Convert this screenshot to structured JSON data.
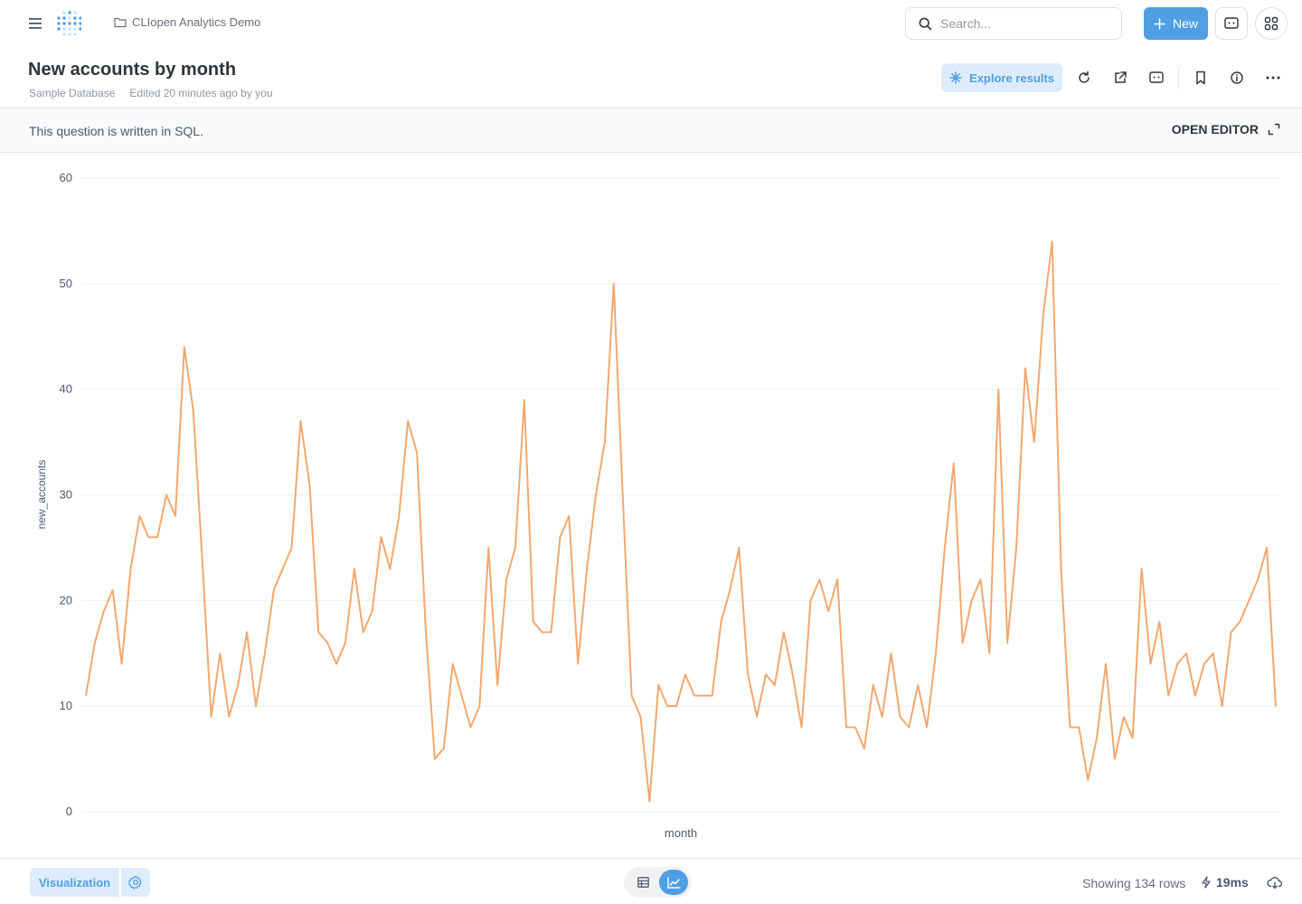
{
  "colors": {
    "accent": "#509ee3",
    "accent_light": "#ddecfa",
    "line": "#f2a86f",
    "text": "#4c5773",
    "border": "#e5e7ea"
  },
  "topbar": {
    "menu_icon": "hamburger-icon",
    "logo_icon": "metabase-logo",
    "breadcrumb": {
      "icon": "folder-icon",
      "label": "CLIopen Analytics Demo"
    },
    "search": {
      "icon": "search-icon",
      "placeholder": "Search..."
    },
    "new_button": {
      "icon": "plus-icon",
      "label": "New"
    },
    "embed_icon": "embed-icon",
    "apps_icon": "apps-grid-icon"
  },
  "header": {
    "title": "New accounts by month",
    "database": "Sample Database",
    "edited": "Edited 20 minutes ago by you",
    "explore_label": "Explore results",
    "icons": [
      "refresh-icon",
      "share-icon",
      "embed-icon",
      "bookmark-icon",
      "info-icon",
      "more-icon"
    ]
  },
  "sql_bar": {
    "message": "This question is written in SQL.",
    "open_editor": "OPEN EDITOR"
  },
  "chart_data": {
    "type": "line",
    "xlabel": "month",
    "ylabel": "new_accounts",
    "ylim": [
      0,
      60
    ],
    "yticks": [
      0,
      10,
      20,
      30,
      40,
      50,
      60
    ],
    "grid": true,
    "series": [
      {
        "values": [
          11,
          16,
          19,
          21,
          14,
          23,
          28,
          26,
          26,
          30,
          28,
          44,
          38,
          24,
          9,
          15,
          9,
          12,
          17,
          10,
          15,
          21,
          23,
          25,
          37,
          31,
          17,
          16,
          14,
          16,
          23,
          17,
          19,
          26,
          23,
          28,
          37,
          34,
          17,
          5,
          6,
          14,
          11,
          8,
          10,
          25,
          12,
          22,
          25,
          39,
          18,
          17,
          17,
          26,
          28,
          14,
          23,
          30,
          35,
          50,
          30,
          11,
          9,
          1,
          12,
          10,
          10,
          13,
          11,
          11,
          11,
          18,
          21,
          25,
          13,
          9,
          13,
          12,
          17,
          13,
          8,
          20,
          22,
          19,
          22,
          8,
          8,
          6,
          12,
          9,
          15,
          9,
          8,
          12,
          8,
          15,
          25,
          33,
          16,
          20,
          22,
          15,
          40,
          16,
          25,
          42,
          35,
          47,
          54,
          23,
          8,
          8,
          3,
          7,
          14,
          5,
          9,
          7,
          23,
          14,
          18,
          11,
          14,
          15,
          11,
          14,
          15,
          10,
          17,
          18,
          20,
          22,
          25,
          10
        ]
      }
    ]
  },
  "footer": {
    "visualization_label": "Visualization",
    "settings_icon": "gear-icon",
    "table_icon": "table-icon",
    "chart_icon": "line-chart-icon",
    "rows_label": "Showing 134 rows",
    "timing_icon": "bolt-icon",
    "timing": "19ms",
    "download_icon": "download-icon"
  }
}
